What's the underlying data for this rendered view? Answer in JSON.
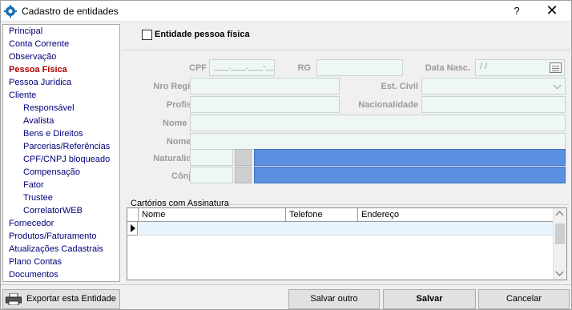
{
  "window": {
    "title": "Cadastro de entidades",
    "help": "?",
    "close": "✕"
  },
  "sidebar": {
    "items": [
      {
        "label": "Principal"
      },
      {
        "label": "Conta Corrente"
      },
      {
        "label": "Observação"
      },
      {
        "label": "Pessoa Física",
        "active": true
      },
      {
        "label": "Pessoa Jurídica"
      },
      {
        "label": "Cliente"
      },
      {
        "label": "Responsável"
      },
      {
        "label": "Avalista"
      },
      {
        "label": "Bens e Direitos"
      },
      {
        "label": "Parcerias/Referências"
      },
      {
        "label": "CPF/CNPJ bloqueado"
      },
      {
        "label": "Compensação"
      },
      {
        "label": "Fator"
      },
      {
        "label": "Trustee"
      },
      {
        "label": "CorrelatorWEB"
      },
      {
        "label": "Fornecedor"
      },
      {
        "label": "Produtos/Faturamento"
      },
      {
        "label": "Atualizações Cadastrais"
      },
      {
        "label": "Plano Contas"
      },
      {
        "label": "Documentos"
      }
    ]
  },
  "form": {
    "pessoa_fisica_checkbox": {
      "label": "Entidade pessoa física",
      "checked": false
    },
    "cpf": {
      "label": "CPF",
      "value": "___.___.___-__"
    },
    "rg": {
      "label": "RG",
      "value": ""
    },
    "data_nasc": {
      "label": "Data Nasc.",
      "value": " / /"
    },
    "nro_registro": {
      "label": "Nro Registro",
      "value": ""
    },
    "est_civil": {
      "label": "Est. Civil",
      "value": ""
    },
    "profissao": {
      "label": "Profissão",
      "value": ""
    },
    "nacionalidade": {
      "label": "Nacionalidade",
      "value": ""
    },
    "nome_mae": {
      "label": "Nome Mãe",
      "value": ""
    },
    "nome_pai": {
      "label": "Nome Pai",
      "value": ""
    },
    "naturalidade": {
      "label": "Naturalidade",
      "code": "",
      "value": ""
    },
    "conjuge": {
      "label": "Cônjuge",
      "code": "",
      "value": ""
    }
  },
  "cartorios": {
    "title": "Cartórios com Assinatura",
    "columns": [
      "Nome",
      "Telefone",
      "Endereço"
    ],
    "rows": []
  },
  "buttons": {
    "export": "Exportar esta Entidade",
    "save_other": "Salvar outro",
    "save": "Salvar",
    "cancel": "Cancelar"
  },
  "colors": {
    "nav_link": "#00007a",
    "nav_active": "#b00000",
    "field_bg": "#eef7f4",
    "lookup_blue": "#5b8fe0"
  }
}
